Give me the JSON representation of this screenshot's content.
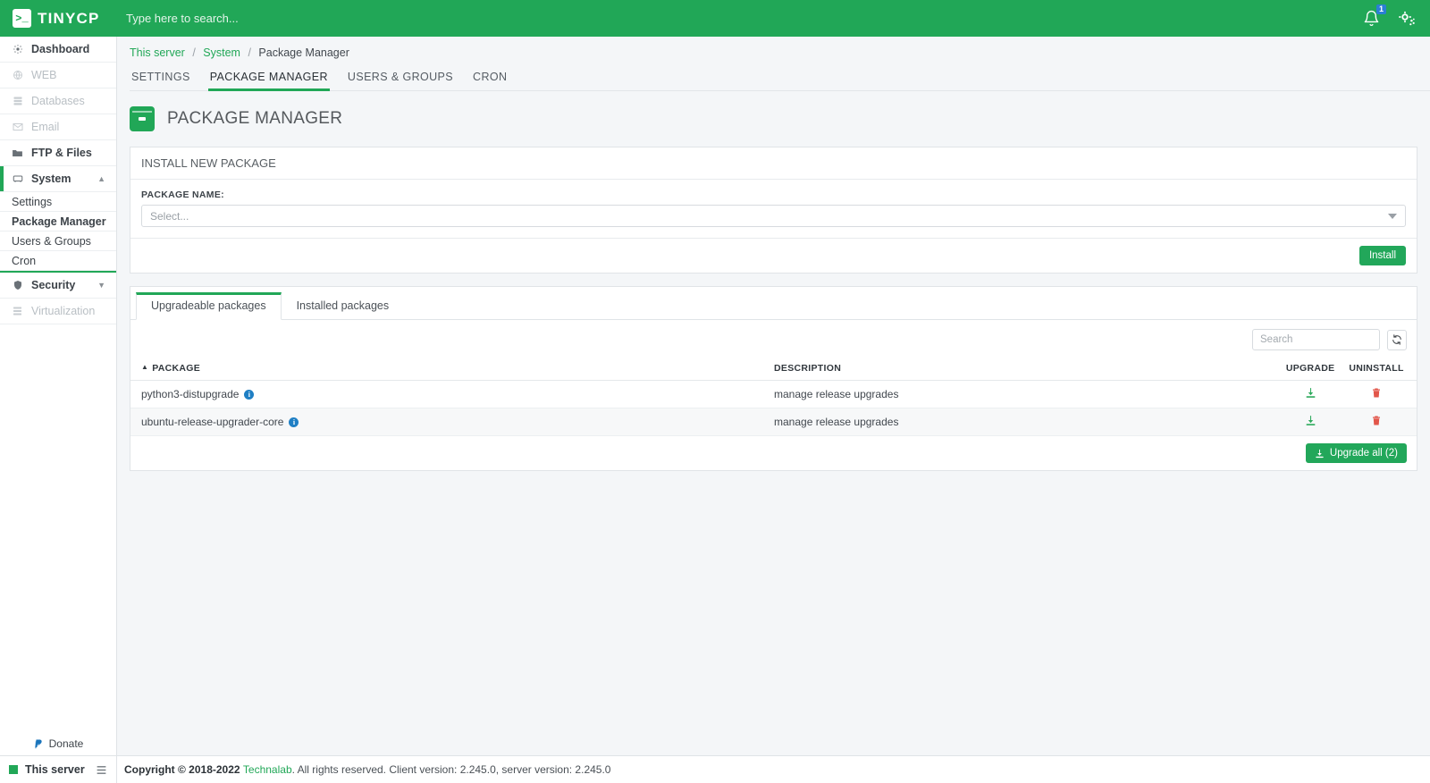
{
  "topbar": {
    "logo_mark": ">_",
    "logo_text": "TINYCP",
    "search_placeholder": "Type here to search...",
    "search_value": "",
    "notifications_icon": "bell-icon",
    "notifications_count": "1",
    "settings_icon": "gears-icon",
    "brand_color": "#21a757"
  },
  "sidebar": {
    "items": [
      {
        "label": "Dashboard",
        "icon": "dashboard-icon",
        "disabled": false
      },
      {
        "label": "WEB",
        "icon": "globe-icon",
        "disabled": true
      },
      {
        "label": "Databases",
        "icon": "database-icon",
        "disabled": true
      },
      {
        "label": "Email",
        "icon": "envelope-icon",
        "disabled": true
      },
      {
        "label": "FTP & Files",
        "icon": "folder-icon",
        "disabled": false
      },
      {
        "label": "System",
        "icon": "server-icon",
        "disabled": false,
        "expanded": true,
        "caret": "chevron-up-icon"
      },
      {
        "label": "Security",
        "icon": "shield-icon",
        "disabled": false,
        "caret": "chevron-down-icon"
      },
      {
        "label": "Virtualization",
        "icon": "cubes-icon",
        "disabled": true
      }
    ],
    "system_subitems": [
      {
        "label": "Settings",
        "active": false
      },
      {
        "label": "Package Manager",
        "active": true
      },
      {
        "label": "Users & Groups",
        "active": false
      },
      {
        "label": "Cron",
        "active": false
      }
    ],
    "donate_label": "Donate",
    "donate_icon": "paypal-icon",
    "this_server_label": "This server",
    "server_list_icon": "list-icon"
  },
  "breadcrumb": {
    "item1": "This server",
    "item2": "System",
    "item3": "Package Manager",
    "separator": "/"
  },
  "tabs": [
    {
      "label": "SETTINGS",
      "active": false
    },
    {
      "label": "PACKAGE MANAGER",
      "active": true
    },
    {
      "label": "USERS & GROUPS",
      "active": false
    },
    {
      "label": "CRON",
      "active": false
    }
  ],
  "page": {
    "icon": "package-box-icon",
    "title": "PACKAGE MANAGER"
  },
  "install_panel": {
    "heading": "INSTALL NEW PACKAGE",
    "field_label": "PACKAGE NAME:",
    "select_placeholder": "Select...",
    "select_value": "",
    "dropdown_icon": "caret-down-icon",
    "install_button": "Install"
  },
  "package_panel": {
    "tabs": [
      {
        "label": "Upgradeable packages",
        "active": true
      },
      {
        "label": "Installed packages",
        "active": false
      }
    ],
    "search_placeholder": "Search",
    "search_value": "",
    "refresh_icon": "refresh-icon",
    "columns": {
      "package": "PACKAGE",
      "description": "DESCRIPTION",
      "upgrade": "UPGRADE",
      "uninstall": "UNINSTALL",
      "sort_indicator": "▲"
    },
    "rows": [
      {
        "package": "python3-distupgrade",
        "info_icon": "info-icon",
        "description": "manage release upgrades",
        "upgrade_icon": "download-icon",
        "uninstall_icon": "trash-icon"
      },
      {
        "package": "ubuntu-release-upgrader-core",
        "info_icon": "info-icon",
        "description": "manage release upgrades",
        "upgrade_icon": "download-icon",
        "uninstall_icon": "trash-icon"
      }
    ],
    "upgrade_all_label": "Upgrade all (2)",
    "upgrade_all_icon": "download-icon"
  },
  "footer": {
    "copyright_bold": "Copyright © 2018-2022",
    "company": "Technalab",
    "rest": ". All rights reserved. Client version: 2.245.0, server version: 2.245.0"
  }
}
